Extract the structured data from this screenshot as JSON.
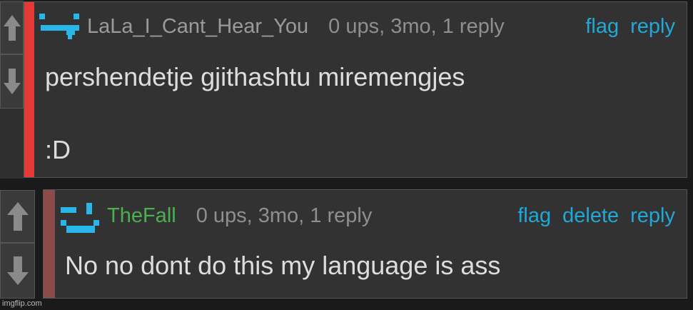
{
  "comments": [
    {
      "username": "LaLa_I_Cant_Hear_You",
      "meta": "0 ups, 3mo, 1 reply",
      "actions": [
        "flag",
        "reply"
      ],
      "lines": [
        "pershendetje gjithashtu miremengjes",
        ":D"
      ],
      "avatar_icon": "pixel-face-icon",
      "stripe_color": "#e53935",
      "username_color": "#9a9a9a"
    },
    {
      "username": "TheFall",
      "meta": "0 ups, 3mo, 1 reply",
      "actions": [
        "flag",
        "delete",
        "reply"
      ],
      "lines": [
        "No no dont do this my language is ass"
      ],
      "avatar_icon": "pixel-face-icon",
      "stripe_color": "#8d4a4a",
      "username_color": "#4caf50"
    }
  ],
  "accent_color": "#21a8d8",
  "vote_icons": [
    "upvote-arrow-icon",
    "downvote-arrow-icon"
  ],
  "watermark": "imgflip.com"
}
